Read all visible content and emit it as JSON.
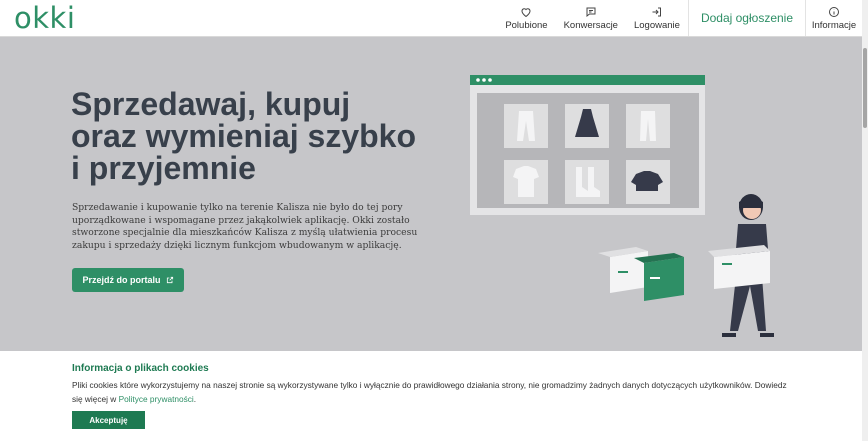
{
  "header": {
    "logo": "okki",
    "nav": [
      {
        "label": "Polubione",
        "icon": "heart-icon"
      },
      {
        "label": "Konwersacje",
        "icon": "chat-icon"
      },
      {
        "label": "Logowanie",
        "icon": "login-icon"
      }
    ],
    "cta": "Dodaj ogłoszenie",
    "info": {
      "label": "Informacje",
      "icon": "info-icon"
    }
  },
  "hero": {
    "title_lines": [
      "Sprzedawaj, kupuj",
      "oraz wymieniaj szybko",
      "i przyjemnie"
    ],
    "description": "Sprzedawanie i kupowanie tylko na terenie Kalisza nie było do tej pory uporządkowane i wspomagane przez jakąkolwiek aplikację. Okki zostało stworzone specjalnie dla mieszkańców Kalisza z myślą ułatwienia procesu zakupu i sprzedaży dzięki licznym funkcjom wbudowanym w aplikację.",
    "button": "Przejdź do portalu"
  },
  "cookie": {
    "title": "Informacja o plikach cookies",
    "text": "Pliki cookies które wykorzystujemy na naszej stronie są wykorzystywane tylko i wyłącznie do prawidłowego działania strony, nie gromadzimy żadnych danych dotyczących użytkowników. Dowiedz się więcej w",
    "link": "Polityce prywatności",
    "after_link": ".",
    "accept": "Akceptuję"
  },
  "colors": {
    "brand": "#2e8f66",
    "hero_bg": "#c6c6c9",
    "title": "#38404b"
  }
}
